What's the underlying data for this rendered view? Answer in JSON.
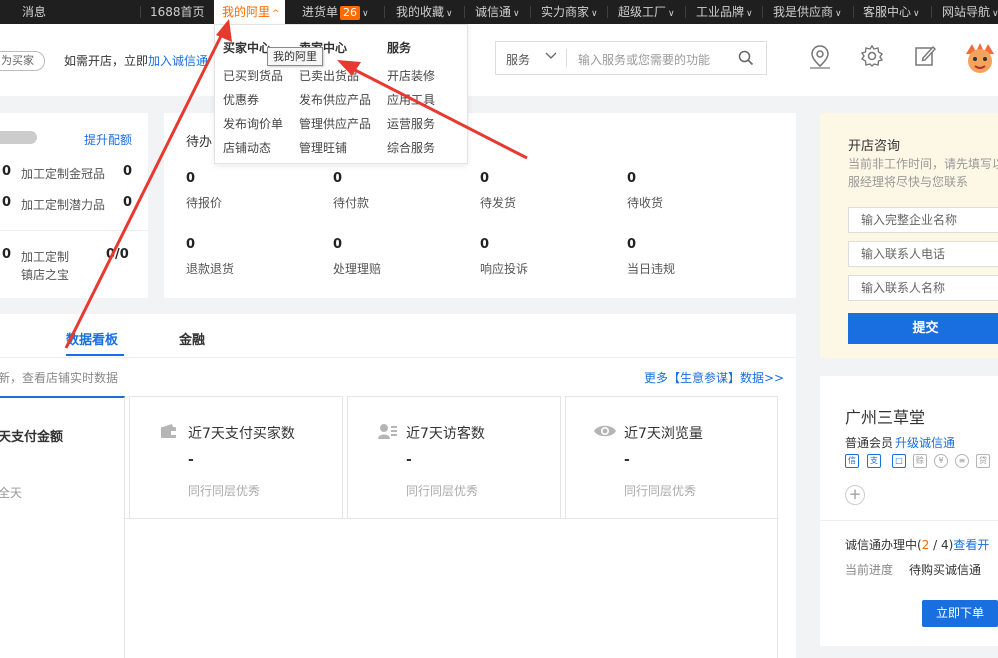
{
  "topbar": {
    "messages": "消息",
    "home": "1688首页",
    "my_ali": "我的阿里",
    "cart": "进货单",
    "cart_count": "26",
    "favorites": "我的收藏",
    "chengxintong": "诚信通",
    "strong_merchant": "实力商家",
    "super_factory": "超级工厂",
    "industrial_brand": "工业品牌",
    "i_am_supplier": "我是供应商",
    "customer_service": "客服中心",
    "site_nav": "网站导航"
  },
  "dropdown": {
    "tooltip": "我的阿里",
    "columns": [
      {
        "head": "买家中心",
        "items": [
          "已买到货品",
          "优惠券",
          "发布询价单",
          "店铺动态"
        ]
      },
      {
        "head": "卖家中心",
        "items": [
          "已卖出货品",
          "发布供应产品",
          "管理供应产品",
          "管理旺铺"
        ]
      },
      {
        "head": "服务",
        "items": [
          "开店装修",
          "应用工具",
          "运营服务",
          "综合服务"
        ]
      }
    ]
  },
  "header": {
    "buyer_btn": "为买家",
    "open_prefix": "如需开店，立即",
    "open_link": "加入诚信通",
    "search_category": "服务",
    "search_placeholder": "输入服务或您需要的功能"
  },
  "left_card": {
    "upgrade_link": "提升配额",
    "rows": [
      {
        "num1": "0",
        "label": "加工定制金冠品",
        "num2": "0"
      },
      {
        "num1": "0",
        "label": "加工定制潜力品",
        "num2": "0"
      },
      {
        "num1": "0",
        "label": "加工定制",
        "label2": "镇店之宝",
        "num2": "0/0"
      }
    ]
  },
  "tasks": {
    "title": "待办",
    "items": [
      {
        "num": "0",
        "label": "待报价"
      },
      {
        "num": "0",
        "label": "待付款"
      },
      {
        "num": "0",
        "label": "待发货"
      },
      {
        "num": "0",
        "label": "待收货"
      },
      {
        "num": "0",
        "label": "退款退货"
      },
      {
        "num": "0",
        "label": "处理理赔"
      },
      {
        "num": "0",
        "label": "响应投诉"
      },
      {
        "num": "0",
        "label": "当日违规"
      }
    ]
  },
  "data_panel": {
    "tabs": [
      "数据看板",
      "金融"
    ],
    "notice": "新，查看店铺实时数据",
    "more_link": "更多【生意参谋】数据>>",
    "first_metric_title": "天支付金额",
    "first_metric_sub": "全天",
    "metrics": [
      {
        "title": "近7天支付买家数",
        "value": "-",
        "sub": "同行同层优秀",
        "icon": "wallet-icon"
      },
      {
        "title": "近7天访客数",
        "value": "-",
        "sub": "同行同层优秀",
        "icon": "visitor-icon"
      },
      {
        "title": "近7天浏览量",
        "value": "-",
        "sub": "同行同层优秀",
        "icon": "eye-icon"
      }
    ]
  },
  "consult": {
    "title": "开店咨询",
    "desc_line1": "当前非工作时间，请先填写以",
    "desc_line2": "服经理将尽快与您联系",
    "fields": [
      "输入完整企业名称",
      "输入联系人电话",
      "输入联系人名称"
    ],
    "submit": "提交"
  },
  "shop": {
    "name": "广州三草堂",
    "member_level": "普通会员",
    "upgrade": "升级诚信通",
    "service_icons": [
      "信",
      "支",
      "□",
      "赊",
      "¥",
      "≡",
      "贷"
    ],
    "progress_prefix": "诚信通办理中(",
    "progress_current": "2",
    "progress_sep": " / ",
    "progress_total": "4",
    "progress_suffix": ")",
    "progress_link": "查看开",
    "stage_label": "当前进度",
    "stage_value": "待购买诚信通",
    "order_btn": "立即下单"
  },
  "colors": {
    "accent": "#ff6a00",
    "link": "#1a6fe0",
    "arrow": "#e8382f"
  }
}
